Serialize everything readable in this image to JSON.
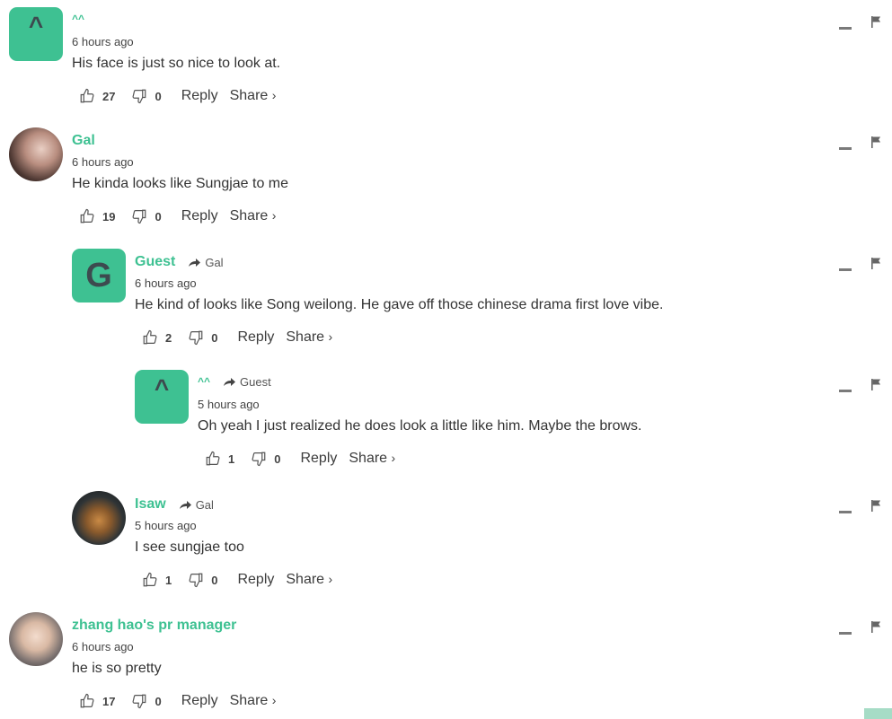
{
  "actions": {
    "reply": "Reply",
    "share": "Share",
    "share_chevron": "›"
  },
  "comments": [
    {
      "name": "^^",
      "avatar_letter": "^",
      "reply_to": "",
      "time": "6 hours ago",
      "text": "His face is just so nice to look at.",
      "likes": "27",
      "dislikes": "0"
    },
    {
      "name": "Gal",
      "reply_to": "",
      "time": "6 hours ago",
      "text": "He kinda looks like Sungjae to me",
      "likes": "19",
      "dislikes": "0"
    },
    {
      "name": "Guest",
      "avatar_letter": "G",
      "reply_to": "Gal",
      "time": "6 hours ago",
      "text": "He kind of looks like Song weilong. He gave off those chinese drama first love vibe.",
      "likes": "2",
      "dislikes": "0"
    },
    {
      "name": "^^",
      "avatar_letter": "^",
      "reply_to": "Guest",
      "time": "5 hours ago",
      "text": "Oh yeah I just realized he does look a little like him. Maybe the brows.",
      "likes": "1",
      "dislikes": "0"
    },
    {
      "name": "Isaw",
      "reply_to": "Gal",
      "time": "5 hours ago",
      "text": "I see sungjae too",
      "likes": "1",
      "dislikes": "0"
    },
    {
      "name": "zhang hao's pr manager",
      "reply_to": "",
      "time": "6 hours ago",
      "text": "he is so pretty",
      "likes": "17",
      "dislikes": "0"
    }
  ],
  "colors": {
    "accent": "#3ec192",
    "text": "#333333",
    "muted": "#444444",
    "scroll_corner": "#a6dcc6"
  }
}
